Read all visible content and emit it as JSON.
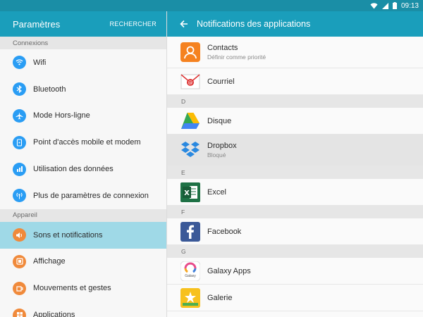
{
  "status": {
    "time": "09:13"
  },
  "left": {
    "title": "Paramètres",
    "search_label": "RECHERCHER",
    "sections": [
      {
        "header": "Connexions",
        "items": [
          {
            "label": "Wifi",
            "icon": "wifi-icon",
            "color": "#2a9df4"
          },
          {
            "label": "Bluetooth",
            "icon": "bluetooth-icon",
            "color": "#2a9df4"
          },
          {
            "label": "Mode Hors-ligne",
            "icon": "airplane-icon",
            "color": "#2a9df4"
          },
          {
            "label": "Point d'accès mobile et modem",
            "icon": "hotspot-icon",
            "color": "#2a9df4"
          },
          {
            "label": "Utilisation des données",
            "icon": "data-usage-icon",
            "color": "#2a9df4"
          },
          {
            "label": "Plus de paramètres de connexion",
            "icon": "more-connections-icon",
            "color": "#2a9df4"
          }
        ]
      },
      {
        "header": "Appareil",
        "items": [
          {
            "label": "Sons et notifications",
            "icon": "sound-icon",
            "color": "#f08a3b",
            "selected": true
          },
          {
            "label": "Affichage",
            "icon": "display-icon",
            "color": "#f08a3b"
          },
          {
            "label": "Mouvements et gestes",
            "icon": "gestures-icon",
            "color": "#f08a3b"
          },
          {
            "label": "Applications",
            "icon": "apps-icon",
            "color": "#f08a3b"
          }
        ]
      }
    ]
  },
  "right": {
    "title": "Notifications des applications",
    "rows": [
      {
        "kind": "app",
        "name": "Contacts",
        "sub": "Définir comme priorité",
        "icon": "contacts-icon"
      },
      {
        "kind": "app",
        "name": "Courriel",
        "icon": "email-icon"
      },
      {
        "kind": "letter",
        "label": "D"
      },
      {
        "kind": "app",
        "name": "Disque",
        "icon": "drive-icon"
      },
      {
        "kind": "app",
        "name": "Dropbox",
        "sub": "Bloqué",
        "icon": "dropbox-icon",
        "blocked": true
      },
      {
        "kind": "letter",
        "label": "E"
      },
      {
        "kind": "app",
        "name": "Excel",
        "icon": "excel-icon"
      },
      {
        "kind": "letter",
        "label": "F"
      },
      {
        "kind": "app",
        "name": "Facebook",
        "icon": "facebook-icon"
      },
      {
        "kind": "letter",
        "label": "G"
      },
      {
        "kind": "app",
        "name": "Galaxy Apps",
        "icon": "galaxy-apps-icon",
        "icon_text": "Galaxy"
      },
      {
        "kind": "app",
        "name": "Galerie",
        "icon": "gallery-icon"
      }
    ]
  },
  "colors": {
    "appbar": "#1a9ebb",
    "statusbar": "#1a8ea6",
    "selected": "#9fd9e7",
    "connexions": "#2a9df4",
    "appareil": "#f08a3b"
  }
}
